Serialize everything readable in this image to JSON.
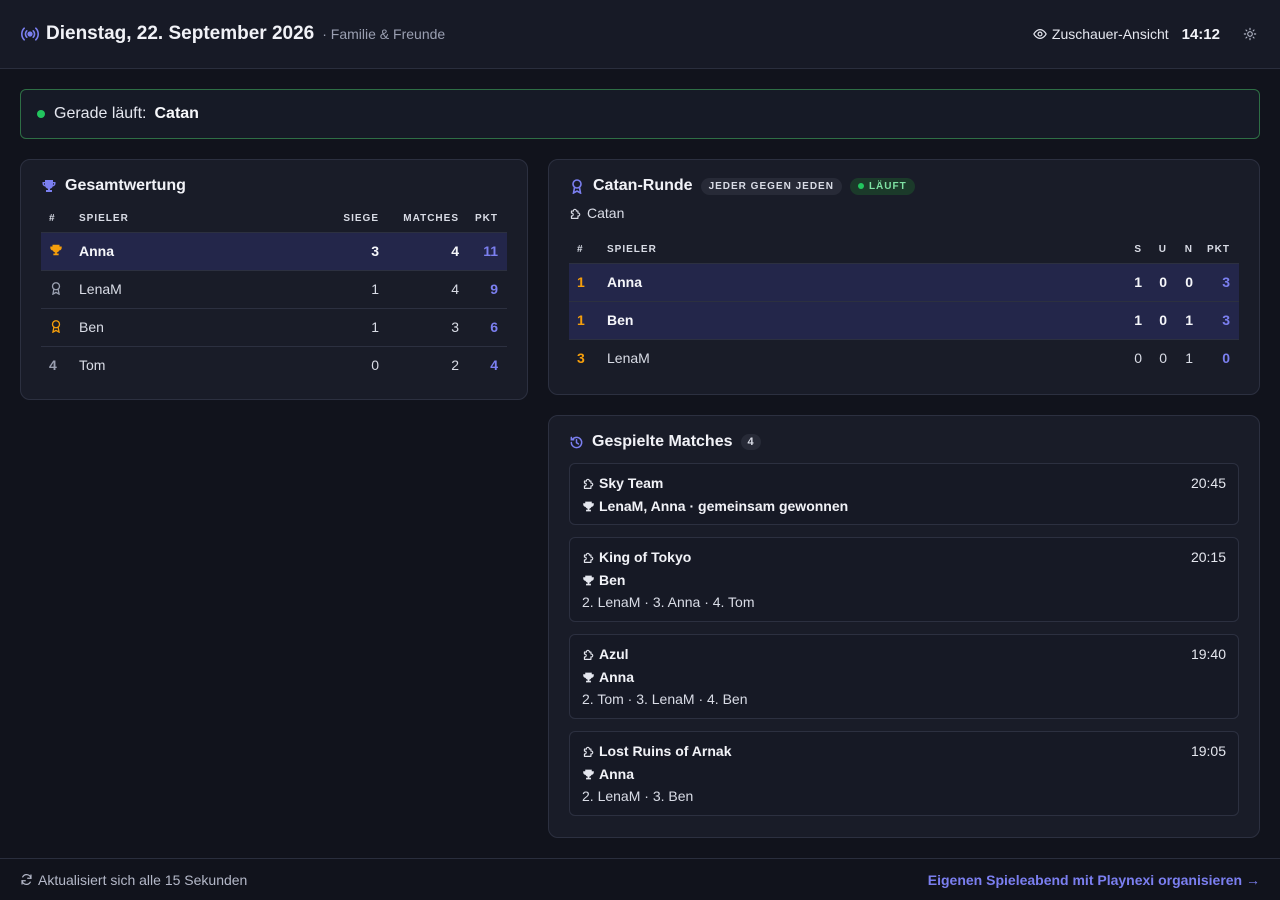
{
  "header": {
    "date": "Dienstag, 22. September 2026",
    "group": "· Familie & Freunde",
    "viewer_label": "Zuschauer-Ansicht",
    "time": "14:12"
  },
  "banner": {
    "label": "Gerade läuft:",
    "game": "Catan"
  },
  "overall": {
    "title": "Gesamtwertung",
    "columns": [
      "#",
      "Spieler",
      "Siege",
      "Matches",
      "Pkt"
    ],
    "rows": [
      {
        "rank": "",
        "medal": "gold",
        "name": "Anna",
        "wins": "3",
        "matches": "4",
        "points": "11"
      },
      {
        "rank": "",
        "medal": "silver",
        "name": "LenaM",
        "wins": "1",
        "matches": "4",
        "points": "9"
      },
      {
        "rank": "",
        "medal": "bronze",
        "name": "Ben",
        "wins": "1",
        "matches": "3",
        "points": "6"
      },
      {
        "rank": "4",
        "medal": "",
        "name": "Tom",
        "wins": "0",
        "matches": "2",
        "points": "4"
      }
    ]
  },
  "round": {
    "title": "Catan-Runde",
    "mode_badge": "Jeder gegen Jeden",
    "status_badge": "Läuft",
    "game": "Catan",
    "columns": [
      "#",
      "Spieler",
      "S",
      "U",
      "N",
      "Pkt"
    ],
    "rows": [
      {
        "rank": "1",
        "name": "Anna",
        "s": "1",
        "u": "0",
        "n": "0",
        "points": "3"
      },
      {
        "rank": "1",
        "name": "Ben",
        "s": "1",
        "u": "0",
        "n": "1",
        "points": "3"
      },
      {
        "rank": "3",
        "name": "LenaM",
        "s": "0",
        "u": "0",
        "n": "1",
        "points": "0"
      }
    ]
  },
  "matches": {
    "title": "Gespielte Matches",
    "count": "4",
    "items": [
      {
        "game": "Sky Team",
        "time": "20:45",
        "winner": "LenaM, Anna · gemeinsam gewonnen",
        "rest": ""
      },
      {
        "game": "King of Tokyo",
        "time": "20:15",
        "winner": "Ben",
        "rest": "2. LenaM · 3. Anna · 4. Tom"
      },
      {
        "game": "Azul",
        "time": "19:40",
        "winner": "Anna",
        "rest": "2. Tom · 3. LenaM · 4. Ben"
      },
      {
        "game": "Lost Ruins of Arnak",
        "time": "19:05",
        "winner": "Anna",
        "rest": "2. LenaM · 3. Ben"
      }
    ]
  },
  "footer": {
    "refresh": "Aktualisiert sich alle 15 Sekunden",
    "cta": "Eigenen Spieleabend mit Playnexi organisieren →"
  },
  "colors": {
    "accent": "#7b7ff0",
    "live": "#22c55e",
    "gold": "#f59e0b",
    "background": "#11131c"
  }
}
